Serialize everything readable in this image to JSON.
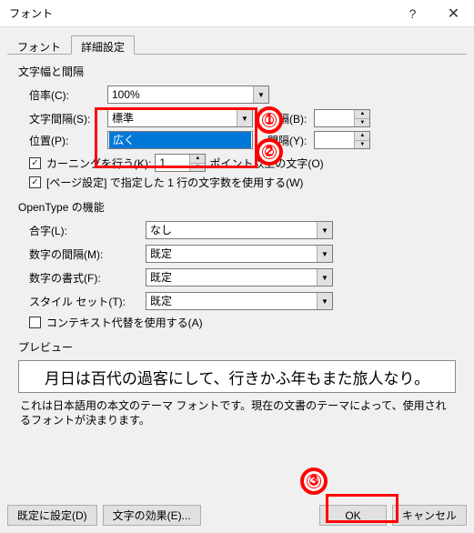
{
  "window": {
    "title": "フォント"
  },
  "tabs": {
    "font": "フォント",
    "advanced": "詳細設定"
  },
  "section1": {
    "title": "文字幅と間隔",
    "ratio_label": "倍率(C):",
    "ratio_value": "100%",
    "spacing_label": "文字間隔(S):",
    "spacing_value": "標準",
    "spacing_option2": "広く",
    "spacing_interval_label": "間隔(B):",
    "position_label": "位置(P):",
    "position_value": "",
    "position_interval_label": "間隔(Y):",
    "kerning_label": "カーニングを行う(K):",
    "kerning_value": "1",
    "kerning_suffix": "ポイント以上の文字(O)",
    "pageset_label": "[ページ設定] で指定した 1 行の文字数を使用する(W)"
  },
  "section2": {
    "title": "OpenType の機能",
    "ligature_label": "合字(L):",
    "ligature_value": "なし",
    "numspacing_label": "数字の間隔(M):",
    "numspacing_value": "既定",
    "numstyle_label": "数字の書式(F):",
    "numstyle_value": "既定",
    "styleset_label": "スタイル セット(T):",
    "styleset_value": "既定",
    "context_label": "コンテキスト代替を使用する(A)"
  },
  "preview": {
    "title": "プレビュー",
    "text": "月日は百代の過客にして、行きかふ年もまた旅人なり。",
    "footnote": "これは日本語用の本文のテーマ フォントです。現在の文書のテーマによって、使用されるフォントが決まります。"
  },
  "buttons": {
    "setdefault": "既定に設定(D)",
    "texteffect": "文字の効果(E)...",
    "ok": "OK",
    "cancel": "キャンセル"
  },
  "annotations": {
    "a1": "1",
    "a2": "2",
    "a3": "3"
  }
}
